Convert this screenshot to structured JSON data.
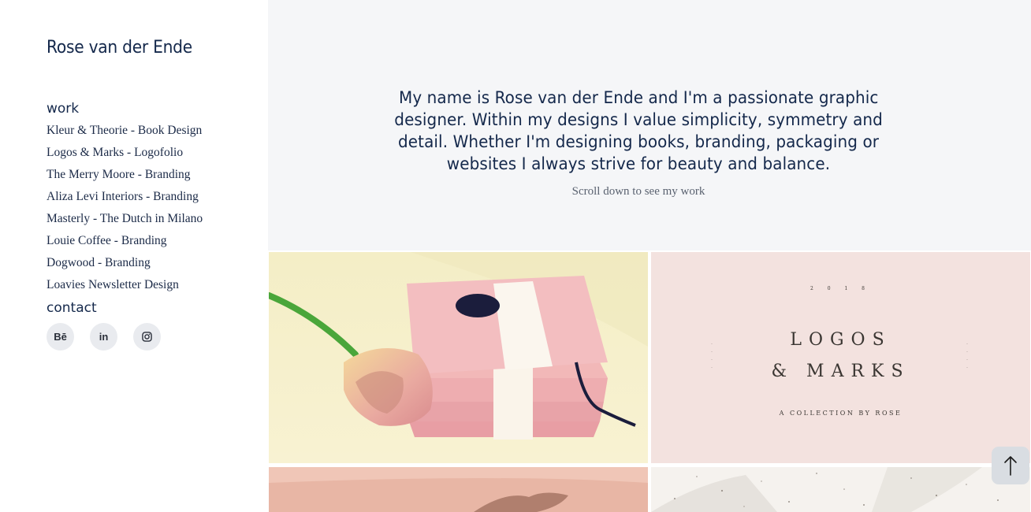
{
  "site": {
    "title": "Rose van der Ende"
  },
  "nav": {
    "work_heading": "work",
    "items": [
      "Kleur & Theorie - Book Design",
      "Logos & Marks - Logofolio",
      "The Merry Moore - Branding",
      "Aliza Levi Interiors - Branding",
      "Masterly - The Dutch in Milano",
      "Louie Coffee - Branding",
      "Dogwood - Branding",
      "Loavies Newsletter Design"
    ],
    "contact_heading": "contact"
  },
  "socials": {
    "behance": "Bē",
    "linkedin": "in",
    "instagram_icon": "instagram-icon"
  },
  "intro": {
    "line1": "My name is Rose van der Ende and I'm a passionate graphic",
    "line2": "designer. Within my designs I value simplicity, symmetry and",
    "line3": "detail. Whether I'm designing books, branding, packaging or",
    "line4": "websites I always strive for beauty and balance.",
    "scroll_hint": "Scroll down to see my work"
  },
  "tiles": {
    "logos": {
      "year": "2 0 1 8",
      "title_line1": "LOGOS",
      "title_line2": "& MARKS",
      "subtitle": "A COLLECTION BY ROSE"
    }
  },
  "colors": {
    "text_navy": "#14284b",
    "intro_bg": "#f5f6f8",
    "social_bg": "#e9ebef"
  },
  "back_to_top": {
    "icon": "arrow-up-icon"
  }
}
